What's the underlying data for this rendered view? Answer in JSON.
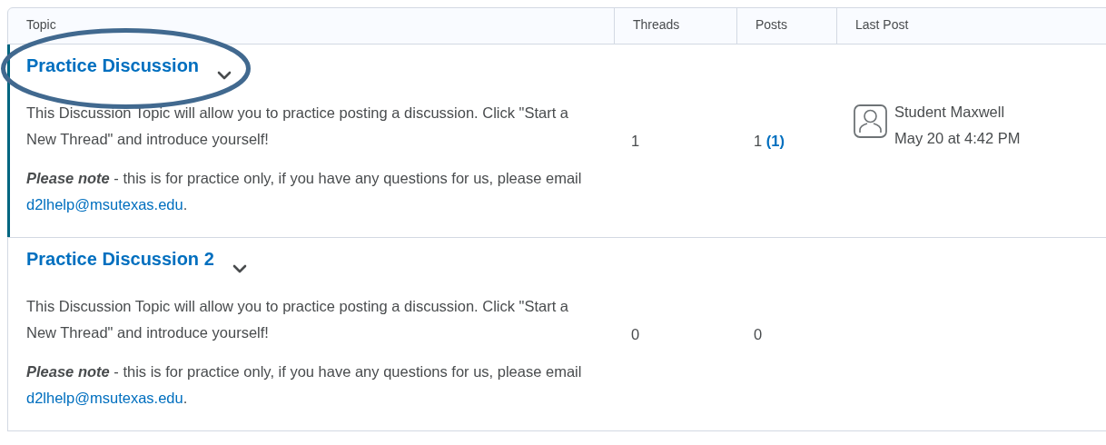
{
  "table": {
    "columns": [
      "Topic",
      "Threads",
      "Posts",
      "Last Post"
    ],
    "rows": [
      {
        "selected": true,
        "title": "Practice Discussion",
        "description": "This Discussion Topic will allow you to practice posting a discussion. Click  \"Start a New Thread\" and introduce yourself!",
        "note": "**Please note** - this is for practice only, if you have any questions for us, please email ",
        "email": "d2lhelp@msutexas.edu",
        "note_end": ".",
        "threads": "1",
        "posts": "1",
        "unread": "(1)",
        "last_post": {
          "author": "Student Maxwell",
          "date": "May 20 at 4:42 PM"
        }
      },
      {
        "selected": false,
        "title": "Practice Discussion 2",
        "description": "This Discussion Topic will allow you to practice posting a discussion. Click  \"Start a New Thread\" and introduce yourself!",
        "note": "**Please note** - this is for practice only, if you have any questions for us, please email ",
        "email": "d2lhelp@msutexas.edu",
        "note_end": ".",
        "threads": "0",
        "posts": "0"
      }
    ]
  },
  "annotation": {
    "kind": "ellipse"
  }
}
